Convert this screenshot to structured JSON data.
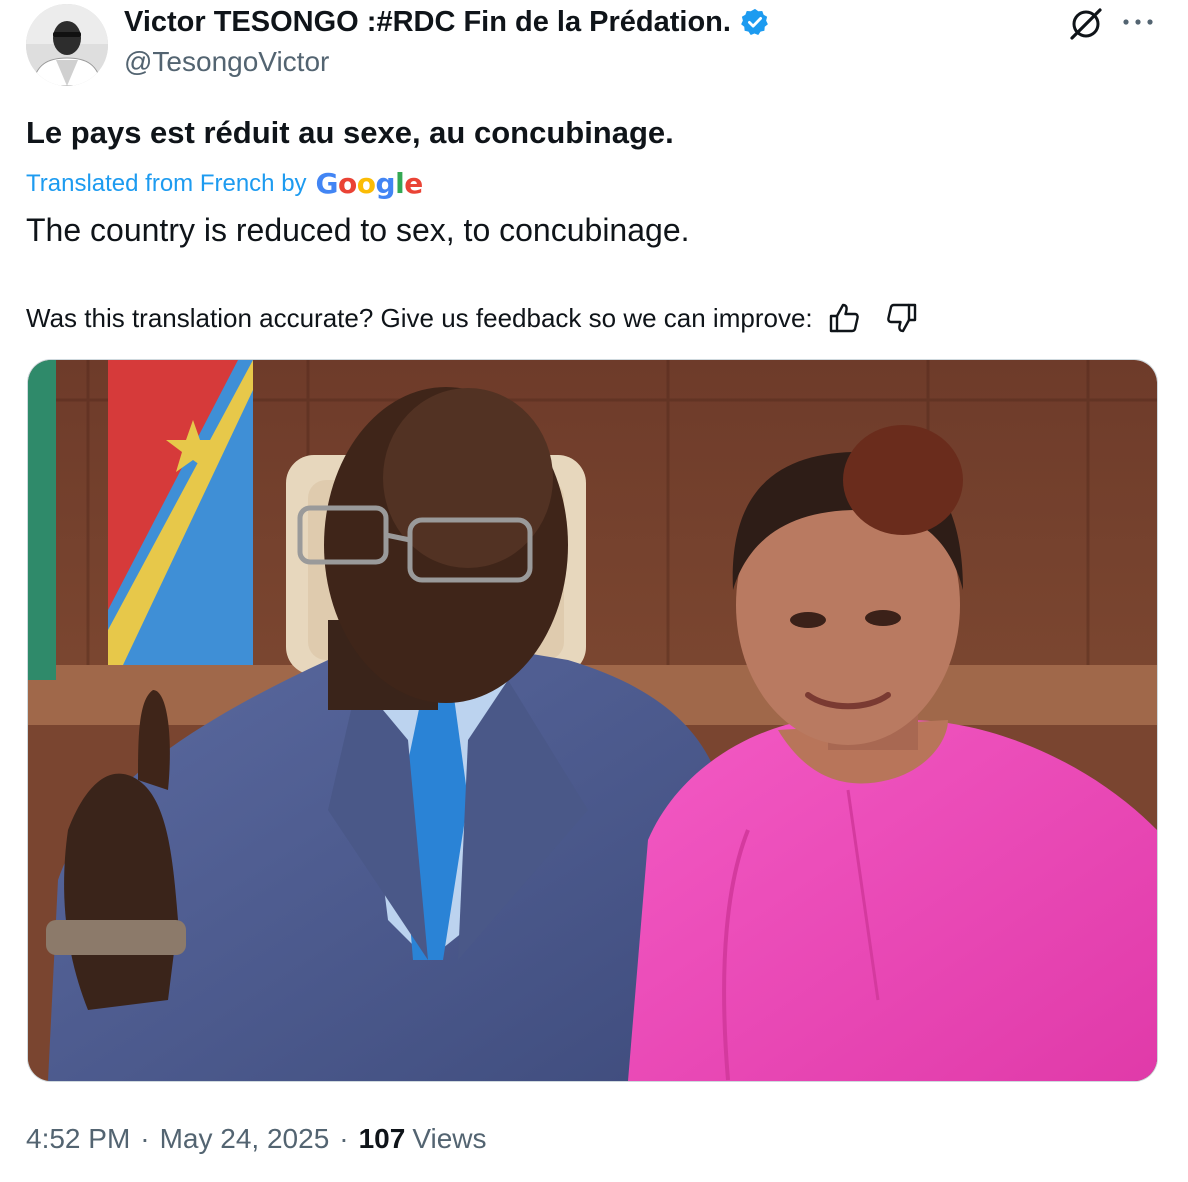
{
  "tweet": {
    "author_name": "Victor TESONGO :#RDC Fin de la Prédation.",
    "author_handle": "@TesongoVictor",
    "text": "Le pays est réduit au sexe, au concubinage.",
    "translated_label": "Translated from French by",
    "translated_provider": "Google",
    "translation": "The country is reduced to sex, to concubinage.",
    "feedback_prompt": "Was this translation accurate? Give us feedback so we can improve:",
    "time": "4:52 PM",
    "date": "May 24, 2025",
    "separator": "·",
    "views_count": "107",
    "views_label": "Views"
  },
  "icons": {
    "verified": "verified-badge-icon",
    "grok": "grok-icon",
    "more": "more-options-icon",
    "thumbs_up": "thumbs-up-icon",
    "thumbs_down": "thumbs-down-icon"
  },
  "colors": {
    "text_primary": "#0f1419",
    "text_secondary": "#536471",
    "accent_blue": "#1d9bf0",
    "border": "#cfd9de",
    "jacket": "#4f5f92",
    "tie": "#2a83d6",
    "dress": "#ee48b8",
    "flag_blue": "#3f8fd6",
    "flag_red": "#d63a3a",
    "flag_yellow": "#e7c84a"
  }
}
